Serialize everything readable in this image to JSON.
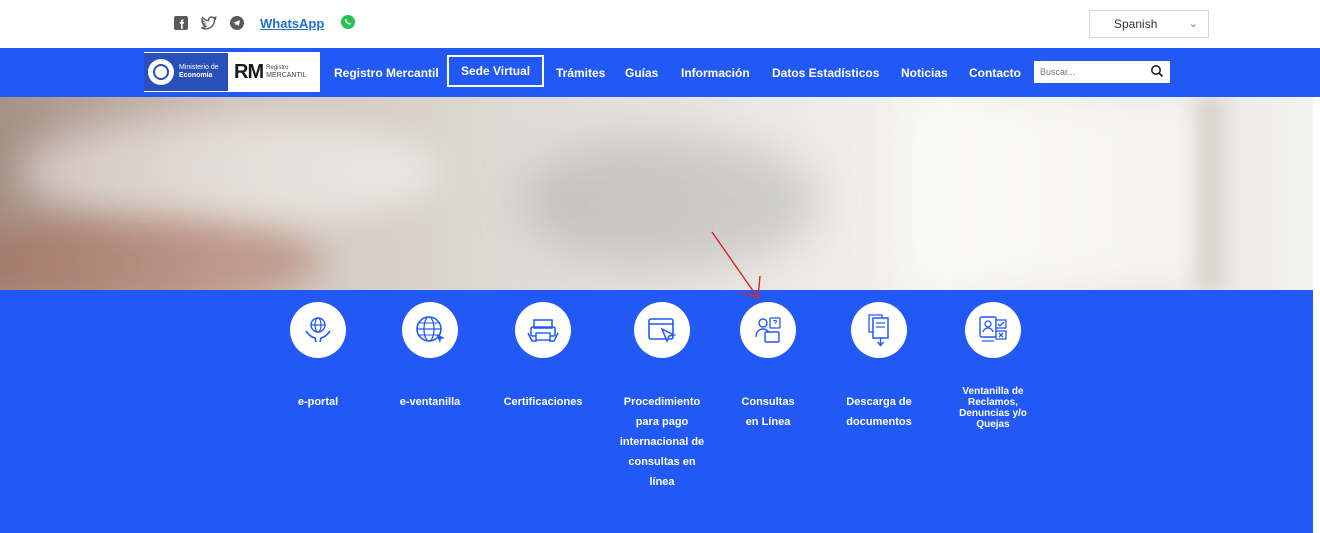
{
  "top_bar": {
    "social_icons": [
      "facebook-icon",
      "twitter-icon",
      "telegram-icon"
    ],
    "whatsapp_label": "WhatsApp",
    "language": {
      "selected": "Spanish"
    }
  },
  "header": {
    "logo_ministry_lines": [
      "Ministerio de",
      "Economía"
    ],
    "logo_rm": "RM",
    "logo_rm_sub": [
      "Registro",
      "MERCANTIL"
    ],
    "nav": [
      {
        "label": "Registro Mercantil"
      },
      {
        "label": "Sede Virtual",
        "active": true
      },
      {
        "label": "Trámites"
      },
      {
        "label": "Guías"
      },
      {
        "label": "Información"
      },
      {
        "label": "Datos Estadísticos"
      },
      {
        "label": "Noticias"
      },
      {
        "label": "Contacto"
      }
    ],
    "search": {
      "placeholder": "Buscar..."
    }
  },
  "services": [
    {
      "label": "e-portal",
      "icon": "hands-globe-icon"
    },
    {
      "label": "e-ventanilla",
      "icon": "globe-cursor-icon"
    },
    {
      "label": "Certificaciones",
      "icon": "printer-hands-icon"
    },
    {
      "label": "Procedimiento para pago internacional de consultas en línea",
      "icon": "browser-cursor-icon"
    },
    {
      "label": "Consultas en Línea",
      "icon": "person-folder-icon"
    },
    {
      "label": "Descarga de documentos",
      "icon": "document-download-icon"
    },
    {
      "label": "Ventanilla de Reclamos, Denuncias y/o Quejas",
      "icon": "id-checklist-icon"
    }
  ],
  "colors": {
    "primary": "#2259f5",
    "white": "#ffffff",
    "annotation": "#e02020"
  }
}
